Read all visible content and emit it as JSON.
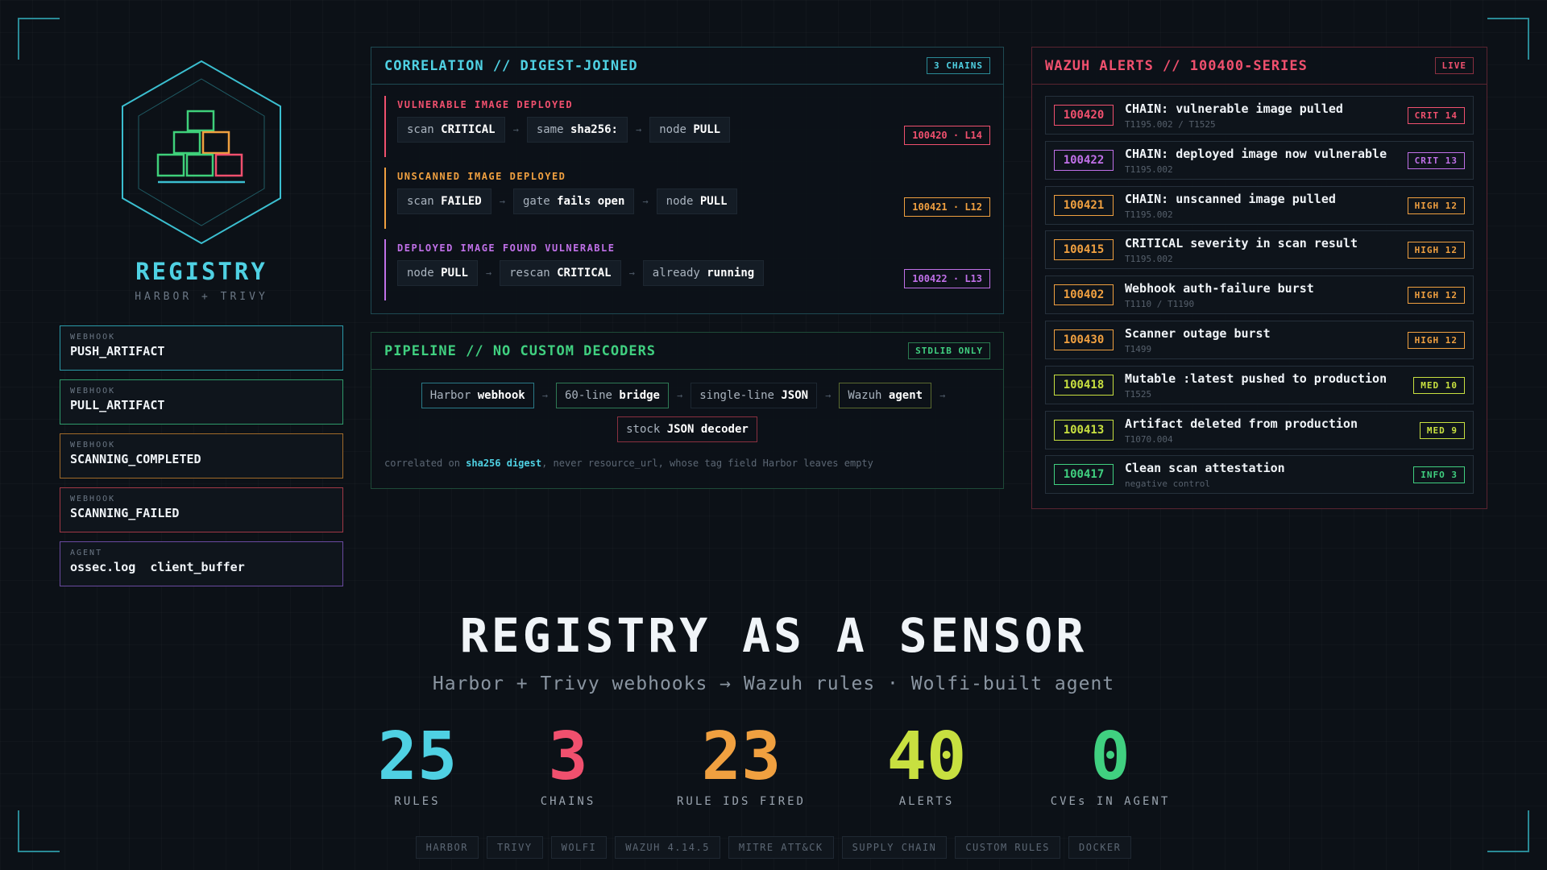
{
  "brand": {
    "title": "REGISTRY",
    "subtitle": "HARBOR + TRIVY"
  },
  "sidebar": [
    {
      "kicker": "WEBHOOK",
      "value": "PUSH_ARTIFACT",
      "color": "#2a9aa8"
    },
    {
      "kicker": "WEBHOOK",
      "value": "PULL_ARTIFACT",
      "color": "#2f9a6a"
    },
    {
      "kicker": "WEBHOOK",
      "value": "SCANNING_COMPLETED",
      "color": "#a06a2a"
    },
    {
      "kicker": "WEBHOOK",
      "value": "SCANNING_FAILED",
      "color": "#a03846"
    },
    {
      "kicker": "AGENT",
      "value": "ossec.log  client_buffer",
      "color": "#6a4aa0"
    }
  ],
  "correlation": {
    "title": "CORRELATION // DIGEST-JOINED",
    "badge": "3 CHAINS",
    "chains": [
      {
        "title": "VULNERABLE IMAGE DEPLOYED",
        "color": "#f0506e",
        "steps": [
          {
            "pre": "scan ",
            "bold": "CRITICAL"
          },
          {
            "pre": "same ",
            "bold": "sha256:"
          },
          {
            "pre": "node ",
            "bold": "PULL"
          }
        ],
        "rule": "100420 · L14"
      },
      {
        "title": "UNSCANNED IMAGE DEPLOYED",
        "color": "#f0a040",
        "steps": [
          {
            "pre": "scan ",
            "bold": "FAILED"
          },
          {
            "pre": "gate ",
            "bold": "fails open"
          },
          {
            "pre": "node ",
            "bold": "PULL"
          }
        ],
        "rule": "100421 · L12"
      },
      {
        "title": "DEPLOYED IMAGE FOUND VULNERABLE",
        "color": "#c070e8",
        "steps": [
          {
            "pre": "node ",
            "bold": "PULL"
          },
          {
            "pre": "rescan ",
            "bold": "CRITICAL"
          },
          {
            "pre": "already ",
            "bold": "running"
          }
        ],
        "rule": "100422 · L13"
      }
    ]
  },
  "pipeline": {
    "title": "PIPELINE // NO CUSTOM DECODERS",
    "badge": "STDLIB ONLY",
    "row1": [
      {
        "pre": "Harbor ",
        "bold": "webhook",
        "color": "#2a7a88"
      },
      {
        "pre": "60-line ",
        "bold": "bridge",
        "color": "#2f7a55"
      },
      {
        "pre": "single-line ",
        "bold": "JSON",
        "color": "#1d2731"
      },
      {
        "pre": "Wazuh ",
        "bold": "agent",
        "color": "#5a6a30"
      }
    ],
    "row2": [
      {
        "pre": "stock ",
        "bold": "JSON decoder",
        "color": "#8a3040"
      }
    ],
    "note_pre": "correlated on ",
    "note_bold": "sha256 digest",
    "note_post": ", never resource_url, whose tag field Harbor leaves empty"
  },
  "alerts": {
    "title": "WAZUH ALERTS // 100400-SERIES",
    "badge": "LIVE",
    "items": [
      {
        "id": "100420",
        "title": "CHAIN: vulnerable image pulled",
        "sub": "T1195.002 / T1525",
        "sev": "CRIT 14",
        "color": "#f0506e"
      },
      {
        "id": "100422",
        "title": "CHAIN: deployed image now vulnerable",
        "sub": "T1195.002",
        "sev": "CRIT 13",
        "color": "#c070e8"
      },
      {
        "id": "100421",
        "title": "CHAIN: unscanned image pulled",
        "sub": "T1195.002",
        "sev": "HIGH 12",
        "color": "#f0a040"
      },
      {
        "id": "100415",
        "title": "CRITICAL severity in scan result",
        "sub": "T1195.002",
        "sev": "HIGH 12",
        "color": "#f0a040"
      },
      {
        "id": "100402",
        "title": "Webhook auth-failure burst",
        "sub": "T1110 / T1190",
        "sev": "HIGH 12",
        "color": "#f0a040"
      },
      {
        "id": "100430",
        "title": "Scanner outage burst",
        "sub": "T1499",
        "sev": "HIGH 12",
        "color": "#f0a040"
      },
      {
        "id": "100418",
        "title": "Mutable :latest pushed to production",
        "sub": "T1525",
        "sev": "MED 10",
        "color": "#c8e040"
      },
      {
        "id": "100413",
        "title": "Artifact deleted from production",
        "sub": "T1070.004",
        "sev": "MED 9",
        "color": "#c8e040"
      },
      {
        "id": "100417",
        "title": "Clean scan attestation",
        "sub": "negative control",
        "sev": "INFO 3",
        "color": "#40d080"
      }
    ]
  },
  "hero": {
    "title": "REGISTRY AS A SENSOR",
    "subtitle": "Harbor + Trivy webhooks → Wazuh rules · Wolfi-built agent"
  },
  "stats": [
    {
      "value": "25",
      "label": "RULES",
      "color": "#4fd1e3"
    },
    {
      "value": "3",
      "label": "CHAINS",
      "color": "#f0506e"
    },
    {
      "value": "23",
      "label": "RULE IDS FIRED",
      "color": "#f0a040"
    },
    {
      "value": "40",
      "label": "ALERTS",
      "color": "#c8e040"
    },
    {
      "value": "0",
      "label": "CVEs IN AGENT",
      "color": "#40d080"
    }
  ],
  "tags": [
    "HARBOR",
    "TRIVY",
    "WOLFI",
    "WAZUH 4.14.5",
    "MITRE ATT&CK",
    "SUPPLY CHAIN",
    "CUSTOM RULES",
    "DOCKER"
  ]
}
